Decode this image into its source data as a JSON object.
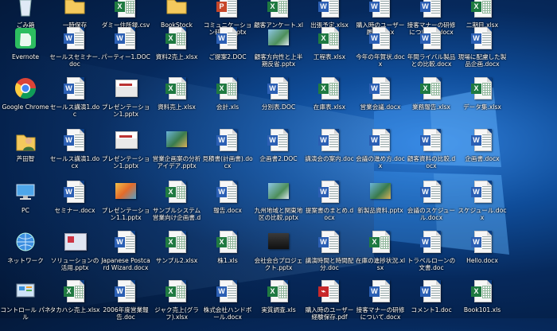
{
  "desktop": {
    "icons": [
      {
        "id": "c0r0",
        "col": 0,
        "row": 0,
        "type": "system",
        "icon": "recycle-bin-icon",
        "label": "ごみ箱"
      },
      {
        "id": "c1r0",
        "col": 1,
        "row": 0,
        "type": "folder",
        "icon": "folder-icon",
        "label": "一時保存"
      },
      {
        "id": "c2r0",
        "col": 2,
        "row": 0,
        "type": "excel",
        "icon": "excel-file-icon",
        "label": "ダミー住所録.csv"
      },
      {
        "id": "c3r0",
        "col": 3,
        "row": 0,
        "type": "folder",
        "icon": "folder-icon",
        "label": "BookStock"
      },
      {
        "id": "c4r0",
        "col": 4,
        "row": 0,
        "type": "ppt",
        "icon": "powerpoint-file-icon",
        "label": "コミュニケーション研修2.pptx"
      },
      {
        "id": "c5r0",
        "col": 5,
        "row": 0,
        "type": "excel",
        "icon": "excel-file-icon",
        "label": "顧客アンケート.xlsx"
      },
      {
        "id": "c6r0",
        "col": 6,
        "row": 0,
        "type": "word",
        "icon": "word-file-icon",
        "label": "出張予定.xlsx"
      },
      {
        "id": "c7r0",
        "col": 7,
        "row": 0,
        "type": "word",
        "icon": "word-file-icon",
        "label": "購入時のユーザー履歴.pptx"
      },
      {
        "id": "c8r0",
        "col": 8,
        "row": 0,
        "type": "word",
        "icon": "word-file-icon",
        "label": "接客マナーの研修について2.docx"
      },
      {
        "id": "c9r0",
        "col": 9,
        "row": 0,
        "type": "excel",
        "icon": "excel-file-icon",
        "label": "二期目.xlsx"
      },
      {
        "id": "c0r1",
        "col": 0,
        "row": 1,
        "type": "app",
        "icon": "evernote-icon",
        "label": "Evernote"
      },
      {
        "id": "c1r1",
        "col": 1,
        "row": 1,
        "type": "word",
        "icon": "word-file-icon",
        "label": "セールスセミナー.doc"
      },
      {
        "id": "c2r1",
        "col": 2,
        "row": 1,
        "type": "word",
        "icon": "word-file-icon",
        "label": "パーティー1.DOC"
      },
      {
        "id": "c3r1",
        "col": 3,
        "row": 1,
        "type": "excel",
        "icon": "excel-file-icon",
        "label": "資料2売上.xlsx"
      },
      {
        "id": "c4r1",
        "col": 4,
        "row": 1,
        "type": "word",
        "icon": "word-file-icon",
        "label": "ご提案2.DOC"
      },
      {
        "id": "c5r1",
        "col": 5,
        "row": 1,
        "type": "thumb-map",
        "icon": "image-file-icon",
        "label": "顧客方向性と上半期反省.pptx"
      },
      {
        "id": "c6r1",
        "col": 6,
        "row": 1,
        "type": "excel",
        "icon": "excel-file-icon",
        "label": "工程表.xlsx"
      },
      {
        "id": "c7r1",
        "col": 7,
        "row": 1,
        "type": "word",
        "icon": "word-file-icon",
        "label": "今年の年賀状.docx"
      },
      {
        "id": "c8r1",
        "col": 8,
        "row": 1,
        "type": "word",
        "icon": "word-file-icon",
        "label": "年間ライバル製品との比較.docx"
      },
      {
        "id": "c9r1",
        "col": 9,
        "row": 1,
        "type": "word",
        "icon": "word-file-icon",
        "label": "現場に配慮した製品企画.docx"
      },
      {
        "id": "c0r2",
        "col": 0,
        "row": 2,
        "type": "app",
        "icon": "google-chrome-icon",
        "label": "Google Chrome"
      },
      {
        "id": "c1r2",
        "col": 1,
        "row": 2,
        "type": "word",
        "icon": "word-file-icon",
        "label": "セールス講演1.doc"
      },
      {
        "id": "c2r2",
        "col": 2,
        "row": 2,
        "type": "thumb-pp",
        "icon": "presentation-file-icon",
        "label": "プレゼンテーション1.pptx"
      },
      {
        "id": "c3r2",
        "col": 3,
        "row": 2,
        "type": "excel",
        "icon": "excel-file-icon",
        "label": "資料売上.xlsx"
      },
      {
        "id": "c4r2",
        "col": 4,
        "row": 2,
        "type": "excel",
        "icon": "excel-file-icon",
        "label": "会計.xls"
      },
      {
        "id": "c5r2",
        "col": 5,
        "row": 2,
        "type": "word",
        "icon": "word-file-icon",
        "label": "分別表.DOC"
      },
      {
        "id": "c6r2",
        "col": 6,
        "row": 2,
        "type": "excel",
        "icon": "excel-file-icon",
        "label": "在庫表.xlsx"
      },
      {
        "id": "c7r2",
        "col": 7,
        "row": 2,
        "type": "word",
        "icon": "word-file-icon",
        "label": "営業会議.docx"
      },
      {
        "id": "c8r2",
        "col": 8,
        "row": 2,
        "type": "excel",
        "icon": "excel-file-icon",
        "label": "業務報告.xlsx"
      },
      {
        "id": "c9r2",
        "col": 9,
        "row": 2,
        "type": "excel",
        "icon": "excel-file-icon",
        "label": "データ集.xlsx"
      },
      {
        "id": "c0r3",
        "col": 0,
        "row": 3,
        "type": "user",
        "icon": "user-folder-icon",
        "label": "芦田智"
      },
      {
        "id": "c1r3",
        "col": 1,
        "row": 3,
        "type": "word",
        "icon": "word-file-icon",
        "label": "セールス講演1.docx"
      },
      {
        "id": "c2r3",
        "col": 2,
        "row": 3,
        "type": "thumb-pp",
        "icon": "presentation-file-icon",
        "label": "プレゼンテーション1.pptx"
      },
      {
        "id": "c3r3",
        "col": 3,
        "row": 3,
        "type": "thumb-photo",
        "icon": "image-file-icon",
        "label": "営業企画案の分析アイデア.pptx"
      },
      {
        "id": "c4r3",
        "col": 4,
        "row": 3,
        "type": "word",
        "icon": "word-file-icon",
        "label": "見積書(計画書).docx"
      },
      {
        "id": "c5r3",
        "col": 5,
        "row": 3,
        "type": "word",
        "icon": "word-file-icon",
        "label": "企画書2.DOC"
      },
      {
        "id": "c6r3",
        "col": 6,
        "row": 3,
        "type": "word",
        "icon": "word-file-icon",
        "label": "講演会の案内.doc"
      },
      {
        "id": "c7r3",
        "col": 7,
        "row": 3,
        "type": "word",
        "icon": "word-file-icon",
        "label": "会議の進め方.docx"
      },
      {
        "id": "c8r3",
        "col": 8,
        "row": 3,
        "type": "word",
        "icon": "word-file-icon",
        "label": "顧客資料の比較.docx"
      },
      {
        "id": "c9r3",
        "col": 9,
        "row": 3,
        "type": "word",
        "icon": "word-file-icon",
        "label": "企画書.docx"
      },
      {
        "id": "c0r4",
        "col": 0,
        "row": 4,
        "type": "system",
        "icon": "pc-icon",
        "label": "PC"
      },
      {
        "id": "c1r4",
        "col": 1,
        "row": 4,
        "type": "word",
        "icon": "word-file-icon",
        "label": "セミナー.docx"
      },
      {
        "id": "c2r4",
        "col": 2,
        "row": 4,
        "type": "thumb-kids",
        "icon": "image-file-icon",
        "label": "プレゼンテーション1.1.pptx"
      },
      {
        "id": "c3r4",
        "col": 3,
        "row": 4,
        "type": "excel",
        "icon": "excel-file-icon",
        "label": "サンプルシステム営業向け企画書.docx"
      },
      {
        "id": "c4r4",
        "col": 4,
        "row": 4,
        "type": "word",
        "icon": "word-file-icon",
        "label": "報告.docx"
      },
      {
        "id": "c5r4",
        "col": 5,
        "row": 4,
        "type": "thumb-map",
        "icon": "image-file-icon",
        "label": "九州地域と関東地区の比較.pptx"
      },
      {
        "id": "c6r4",
        "col": 6,
        "row": 4,
        "type": "word",
        "icon": "word-file-icon",
        "label": "提案書のまとめ.docx"
      },
      {
        "id": "c7r4",
        "col": 7,
        "row": 4,
        "type": "thumb-photo",
        "icon": "image-file-icon",
        "label": "新製品資料.pptx"
      },
      {
        "id": "c8r4",
        "col": 8,
        "row": 4,
        "type": "word",
        "icon": "word-file-icon",
        "label": "会議のスケジュール.docx"
      },
      {
        "id": "c9r4",
        "col": 9,
        "row": 4,
        "type": "word",
        "icon": "word-file-icon",
        "label": "スケジュール.docx"
      },
      {
        "id": "c0r5",
        "col": 0,
        "row": 5,
        "type": "system",
        "icon": "network-icon",
        "label": "ネットワーク"
      },
      {
        "id": "c1r5",
        "col": 1,
        "row": 5,
        "type": "thumb-wiz",
        "icon": "presentation-file-icon",
        "label": "ソリューションの活用.pptx"
      },
      {
        "id": "c2r5",
        "col": 2,
        "row": 5,
        "type": "word",
        "icon": "word-file-icon",
        "label": "Japanese Postcard Wizard.docx"
      },
      {
        "id": "c3r5",
        "col": 3,
        "row": 5,
        "type": "excel",
        "icon": "excel-file-icon",
        "label": "サンプル2.xlsx"
      },
      {
        "id": "c4r5",
        "col": 4,
        "row": 5,
        "type": "excel",
        "icon": "excel-file-icon",
        "label": "株1.xls"
      },
      {
        "id": "c5r5",
        "col": 5,
        "row": 5,
        "type": "thumb-dark",
        "icon": "image-file-icon",
        "label": "会社会合プロジェクト.pptx"
      },
      {
        "id": "c6r5",
        "col": 6,
        "row": 5,
        "type": "word",
        "icon": "word-file-icon",
        "label": "講演時間と時間配分.doc"
      },
      {
        "id": "c7r5",
        "col": 7,
        "row": 5,
        "type": "excel",
        "icon": "excel-file-icon",
        "label": "在庫の進捗状況.xlsx"
      },
      {
        "id": "c8r5",
        "col": 8,
        "row": 5,
        "type": "word",
        "icon": "word-file-icon",
        "label": "トラベルローンの文書.doc"
      },
      {
        "id": "c9r5",
        "col": 9,
        "row": 5,
        "type": "word",
        "icon": "word-file-icon",
        "label": "Hello.docx"
      },
      {
        "id": "c0r6",
        "col": 0,
        "row": 6,
        "type": "system",
        "icon": "control-panel-icon",
        "label": "コントロール パネル"
      },
      {
        "id": "c1r6",
        "col": 1,
        "row": 6,
        "type": "excel",
        "icon": "excel-file-icon",
        "label": "タカハシ売上.xlsx"
      },
      {
        "id": "c2r6",
        "col": 2,
        "row": 6,
        "type": "word",
        "icon": "word-file-icon",
        "label": "2006年度営業報告.doc"
      },
      {
        "id": "c3r6",
        "col": 3,
        "row": 6,
        "type": "excel",
        "icon": "excel-file-icon",
        "label": "ジャク売上(グラフ).xlsx"
      },
      {
        "id": "c4r6",
        "col": 4,
        "row": 6,
        "type": "word",
        "icon": "word-file-icon",
        "label": "株式会社ハンドボール.docx"
      },
      {
        "id": "c5r6",
        "col": 5,
        "row": 6,
        "type": "excel",
        "icon": "excel-file-icon",
        "label": "実質調査.xls"
      },
      {
        "id": "c6r6",
        "col": 6,
        "row": 6,
        "type": "pdf",
        "icon": "pdf-file-icon",
        "label": "購入時のユーザー経験保存.pdf"
      },
      {
        "id": "c7r6",
        "col": 7,
        "row": 6,
        "type": "word",
        "icon": "word-file-icon",
        "label": "接客マナーの研修について.docx"
      },
      {
        "id": "c8r6",
        "col": 8,
        "row": 6,
        "type": "word",
        "icon": "word-file-icon",
        "label": "コメント1.doc"
      },
      {
        "id": "c9r6",
        "col": 9,
        "row": 6,
        "type": "excel",
        "icon": "excel-file-icon",
        "label": "Book101.xls"
      }
    ]
  }
}
